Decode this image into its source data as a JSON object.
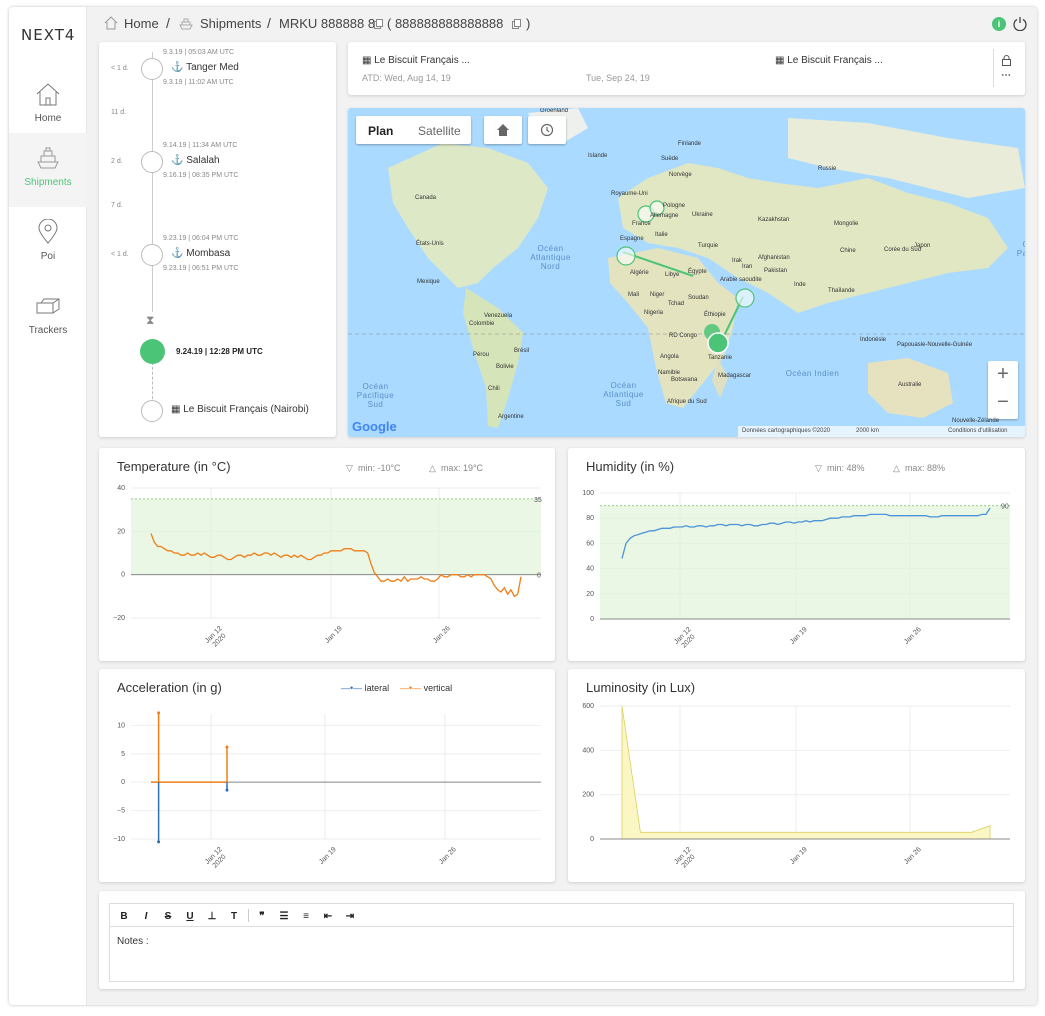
{
  "brand": {
    "logo": "NEXT4"
  },
  "sidebar": {
    "items": [
      {
        "label": "Home",
        "icon": "home-icon"
      },
      {
        "label": "Shipments",
        "icon": "ship-icon",
        "active": true
      },
      {
        "label": "Poi",
        "icon": "map-pin-icon"
      },
      {
        "label": "Trackers",
        "icon": "trackers-icon"
      }
    ]
  },
  "breadcrumb": {
    "home": "Home",
    "shipments": "Shipments",
    "container": "MRKU 888888 8",
    "booking": "( 888888888888888",
    "close_paren": ")"
  },
  "colors": {
    "accent": "#4cc477",
    "temp": "#f07d16",
    "humidity": "#4d93d9",
    "lateral": "#2f6fb5",
    "vertical": "#f07d16"
  },
  "timeline": {
    "stops": [
      {
        "gap_before": "< 1 d.",
        "arrival": "9.3.19",
        "arrival_time": "05:03 AM UTC",
        "port": "Tanger Med",
        "departure": "9.3.19",
        "departure_time": "11:02 AM UTC"
      },
      {
        "gap_before": "11 d."
      },
      {
        "gap_before": "2 d.",
        "arrival": "9.14.19",
        "arrival_time": "11:34 AM UTC",
        "port": "Salalah",
        "departure": "9.16.19",
        "departure_time": "08:35 PM UTC"
      },
      {
        "gap_before": "7 d."
      },
      {
        "gap_before": "< 1 d.",
        "arrival": "9.23.19",
        "arrival_time": "06:04 PM UTC",
        "port": "Mombasa",
        "departure": "9.23.19",
        "departure_time": "06:51 PM UTC"
      }
    ],
    "current_date": "9.24.19",
    "current_time": "12:28 PM UTC",
    "destination": "Le Biscuit Français (Nairobi)"
  },
  "route": {
    "origin": "Le Biscuit Français ...",
    "origin_date": "ATD: Wed, Aug 14, 19",
    "eta": "Tue, Sep 24, 19",
    "destination": "Le Biscuit Français ..."
  },
  "map": {
    "tab_plan": "Plan",
    "tab_satellite": "Satellite",
    "zoom_in": "+",
    "zoom_out": "−",
    "google": "Google",
    "attribution": "Données cartographiques ©2020",
    "scale": "2000 km",
    "terms": "Conditions d'utilisation",
    "labels": [
      {
        "t": "Groenland"
      },
      {
        "t": "Islande"
      },
      {
        "t": "Finlande"
      },
      {
        "t": "Suède"
      },
      {
        "t": "Norvège"
      },
      {
        "t": "Russie"
      },
      {
        "t": "Royaume-Uni"
      },
      {
        "t": "Pologne"
      },
      {
        "t": "Allemagne"
      },
      {
        "t": "Ukraine"
      },
      {
        "t": "France"
      },
      {
        "t": "Kazakhstan"
      },
      {
        "t": "Mongolie"
      },
      {
        "t": "Canada"
      },
      {
        "t": "Italie"
      },
      {
        "t": "Espagne"
      },
      {
        "t": "Turquie"
      },
      {
        "t": "Chine"
      },
      {
        "t": "Corée du Sud"
      },
      {
        "t": "Japon"
      },
      {
        "t": "Afghanistan"
      },
      {
        "t": "Irak"
      },
      {
        "t": "Iran"
      },
      {
        "t": "États-Unis"
      },
      {
        "t": "Océan Atlantique Nord"
      },
      {
        "t": "Algérie"
      },
      {
        "t": "Libye"
      },
      {
        "t": "Égypte"
      },
      {
        "t": "Pakistan"
      },
      {
        "t": "Arabie saoudite"
      },
      {
        "t": "Inde"
      },
      {
        "t": "Mexique"
      },
      {
        "t": "Mali"
      },
      {
        "t": "Niger"
      },
      {
        "t": "Tchad"
      },
      {
        "t": "Soudan"
      },
      {
        "t": "Thaïlande"
      },
      {
        "t": "Nigeria"
      },
      {
        "t": "Éthiopie"
      },
      {
        "t": "Venezuela"
      },
      {
        "t": "Colombie"
      },
      {
        "t": "RD Congo"
      },
      {
        "t": "Indonésie"
      },
      {
        "t": "Papouasie-Nouvelle-Guinée"
      },
      {
        "t": "Brésil"
      },
      {
        "t": "Pérou"
      },
      {
        "t": "Angola"
      },
      {
        "t": "Tanzanie"
      },
      {
        "t": "Bolivie"
      },
      {
        "t": "Namibie"
      },
      {
        "t": "Madagascar"
      },
      {
        "t": "Botswana"
      },
      {
        "t": "Océan Indien"
      },
      {
        "t": "Australie"
      },
      {
        "t": "Chili"
      },
      {
        "t": "Océan Atlantique Sud"
      },
      {
        "t": "Afrique du Sud"
      },
      {
        "t": "Argentine"
      },
      {
        "t": "Nouvelle-Zélande"
      },
      {
        "t": "Océan Pacifique Sud"
      },
      {
        "t": "Océan Pacifique Nord"
      }
    ]
  },
  "charts": {
    "temperature": {
      "title": "Temperature (in °C)",
      "min_label": "min: -10°C",
      "max_label": "max: 19°C"
    },
    "humidity": {
      "title": "Humidity (in %)",
      "min_label": "min: 48%",
      "max_label": "max: 88%"
    },
    "acceleration": {
      "title": "Acceleration (in g)",
      "legend_lateral": "lateral",
      "legend_vertical": "vertical"
    },
    "luminosity": {
      "title": "Luminosity (in Lux)"
    }
  },
  "chart_data": [
    {
      "type": "line",
      "title": "Temperature (in °C)",
      "x": [
        "Jan 12 2020",
        "Jan 19",
        "Jan 26"
      ],
      "ylim": [
        -20,
        40
      ],
      "yticks": [
        -20,
        0,
        20,
        40
      ],
      "threshold_high": 35,
      "threshold_low": 0,
      "series": [
        {
          "values": [
            19,
            15,
            13,
            13,
            12,
            11,
            11,
            10,
            10,
            9,
            9,
            10,
            9,
            9,
            10,
            9,
            10,
            9,
            8,
            8,
            9,
            9,
            8,
            7,
            7,
            8,
            9,
            9,
            8,
            9,
            9,
            10,
            9,
            9,
            10,
            10,
            9,
            10,
            9,
            8,
            9,
            9,
            8,
            9,
            8,
            9,
            8,
            7,
            7,
            8,
            9,
            9,
            10,
            10,
            11,
            11,
            11,
            11,
            12,
            12,
            12,
            11,
            11,
            11,
            11,
            10,
            5,
            1,
            -1,
            -3,
            -3,
            -2,
            -3,
            -3,
            -2,
            -3,
            -1,
            -3,
            -2,
            -2,
            -2,
            -1,
            -2,
            -2,
            -3,
            -3,
            -2,
            0,
            -1,
            -1,
            0,
            0,
            0,
            -1,
            -1,
            0,
            -1,
            0,
            0,
            0,
            0,
            -1,
            -2,
            -5,
            -7,
            -8,
            -6,
            -9,
            -7,
            -10,
            -9,
            -1
          ]
        }
      ]
    },
    {
      "type": "line",
      "title": "Humidity (in %)",
      "x": [
        "Jan 12 2020",
        "Jan 19",
        "Jan 26"
      ],
      "ylim": [
        0,
        100
      ],
      "yticks": [
        0,
        20,
        40,
        60,
        80,
        100
      ],
      "threshold_high": 90,
      "series": [
        {
          "values": [
            48,
            60,
            64,
            66,
            67,
            68,
            69,
            70,
            70,
            71,
            72,
            72,
            72,
            73,
            73,
            73,
            74,
            73,
            73,
            74,
            74,
            73,
            74,
            74,
            75,
            75,
            74,
            75,
            75,
            75,
            74,
            75,
            75,
            74,
            74,
            75,
            75,
            76,
            76,
            75,
            76,
            77,
            77,
            76,
            77,
            77,
            78,
            77,
            78,
            78,
            78,
            79,
            80,
            80,
            80,
            81,
            81,
            81,
            82,
            82,
            82,
            82,
            83,
            83,
            83,
            83,
            83,
            82,
            82,
            82,
            82,
            82,
            82,
            82,
            82,
            82,
            82,
            81,
            81,
            81,
            82,
            82,
            82,
            82,
            82,
            82,
            82,
            82,
            82,
            82,
            83,
            83,
            88
          ]
        }
      ]
    },
    {
      "type": "line",
      "title": "Acceleration (in g)",
      "x": [
        "Jan 12 2020",
        "Jan 19",
        "Jan 26"
      ],
      "ylim": [
        -10,
        12
      ],
      "yticks": [
        -10,
        -5,
        0,
        5,
        10
      ],
      "series": [
        {
          "name": "lateral",
          "events": [
            {
              "t": 0.02,
              "value": -10.5
            },
            {
              "t": 0.2,
              "value": -1.4
            }
          ]
        },
        {
          "name": "vertical",
          "events": [
            {
              "t": 0.02,
              "value": 12.2
            },
            {
              "t": 0.2,
              "value": 6.2
            }
          ]
        }
      ]
    },
    {
      "type": "area",
      "title": "Luminosity (in Lux)",
      "x": [
        "Jan 12 2020",
        "Jan 19",
        "Jan 26"
      ],
      "ylim": [
        0,
        600
      ],
      "yticks": [
        0,
        200,
        400,
        600
      ],
      "series": [
        {
          "values": [
            600,
            30,
            30,
            30,
            30,
            30,
            30,
            30,
            30,
            30,
            30,
            30,
            30,
            30,
            30,
            30,
            30,
            30,
            30,
            30,
            60
          ]
        }
      ]
    }
  ],
  "editor": {
    "tools": [
      "B",
      "I",
      "S",
      "U",
      "⊥",
      "T",
      "❞",
      "☰",
      "≡",
      "⇤",
      "⇥"
    ],
    "placeholder": "Notes :"
  },
  "topbar": {
    "info_label": "i"
  }
}
